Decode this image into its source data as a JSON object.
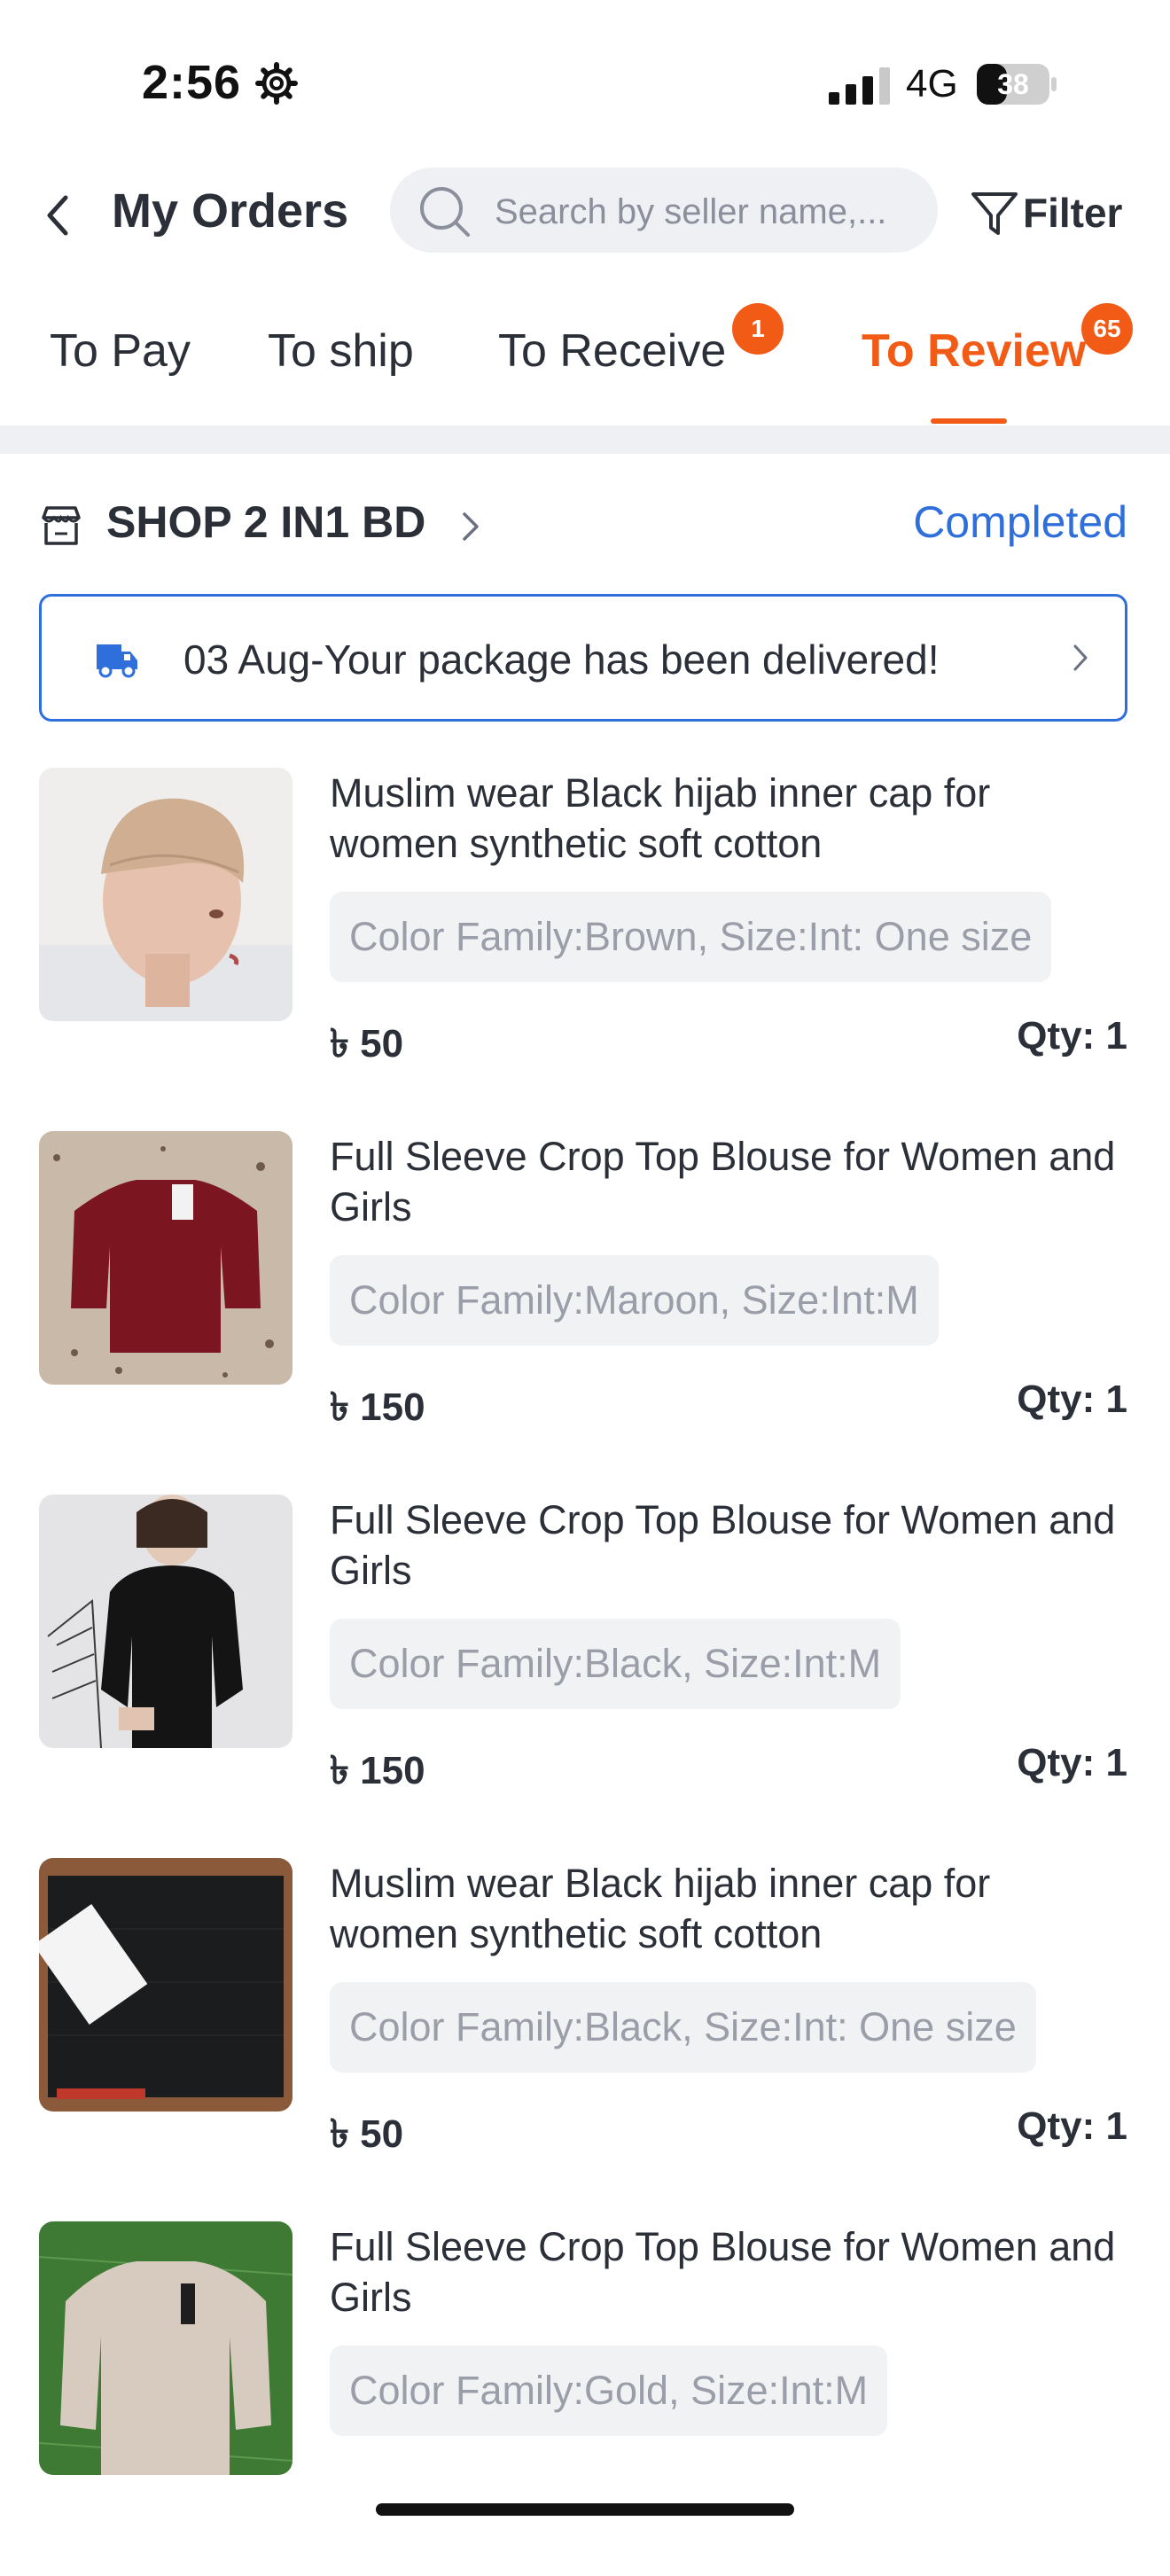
{
  "status_bar": {
    "time": "2:56",
    "network": "4G",
    "battery": "38"
  },
  "header": {
    "title": "My Orders",
    "search_placeholder": "Search by seller name,...",
    "filter_label": "Filter"
  },
  "tabs": [
    {
      "label": "To Pay"
    },
    {
      "label": "To ship"
    },
    {
      "label": "To Receive",
      "badge": "1"
    },
    {
      "label": "To Review",
      "badge": "65",
      "active": true
    }
  ],
  "shop": {
    "name": "SHOP 2 IN1 BD",
    "status": "Completed"
  },
  "delivery": {
    "message": "03 Aug-Your package has been delivered!"
  },
  "items": [
    {
      "title": "Muslim wear Black hijab inner cap for women synthetic soft cotton",
      "variant": "Color Family:Brown, Size:Int: One size",
      "price": "৳ 50",
      "qty": "Qty: 1"
    },
    {
      "title": "Full Sleeve Crop Top Blouse for Women and Girls",
      "variant": "Color Family:Maroon, Size:Int:M",
      "price": "৳ 150",
      "qty": "Qty: 1"
    },
    {
      "title": "Full Sleeve Crop Top Blouse for Women and Girls",
      "variant": "Color Family:Black, Size:Int:M",
      "price": "৳ 150",
      "qty": "Qty: 1"
    },
    {
      "title": "Muslim wear Black hijab inner cap for women synthetic soft cotton",
      "variant": "Color Family:Black, Size:Int: One size",
      "price": "৳ 50",
      "qty": "Qty: 1"
    },
    {
      "title": "Full Sleeve Crop Top Blouse for Women and Girls",
      "variant": "Color Family:Gold, Size:Int:M"
    }
  ],
  "colors": {
    "accent": "#f25b15",
    "link": "#2f6fdc",
    "text": "#2b2f38",
    "muted": "#9a9ea8"
  },
  "icons": [
    "settings-gear-icon",
    "cellular-signal-icon",
    "battery-icon",
    "back-arrow-icon",
    "search-icon",
    "filter-funnel-icon",
    "store-icon",
    "chevron-right-icon",
    "delivery-truck-icon"
  ]
}
